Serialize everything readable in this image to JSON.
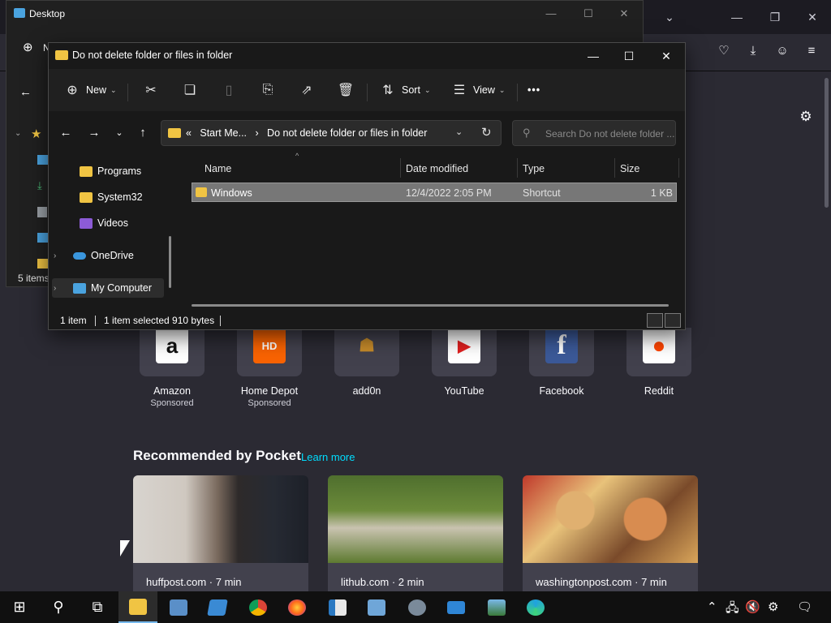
{
  "firefox": {
    "shortcuts": [
      {
        "name": "Amazon",
        "sponsor": "Sponsored",
        "logo": "a"
      },
      {
        "name": "Home Depot",
        "sponsor": "Sponsored",
        "logo": "HD"
      },
      {
        "name": "add0n",
        "sponsor": "",
        "logo": "☗"
      },
      {
        "name": "YouTube",
        "sponsor": "",
        "logo": "▶"
      },
      {
        "name": "Facebook",
        "sponsor": "",
        "logo": "f"
      },
      {
        "name": "Reddit",
        "sponsor": "",
        "logo": "●"
      }
    ],
    "pocket": {
      "title": "Recommended by Pocket",
      "learn_more": "Learn more",
      "cards": [
        {
          "source": "huffpost.com · 7 min"
        },
        {
          "source": "lithub.com · 2 min"
        },
        {
          "source": "washingtonpost.com · 7 min"
        }
      ]
    }
  },
  "bg_explorer": {
    "title": "Desktop",
    "status": "5 items",
    "new_partial": "N"
  },
  "explorer": {
    "title": "Do not delete folder or files in folder",
    "commands": {
      "new": "New",
      "sort": "Sort",
      "view": "View",
      "more": "•••"
    },
    "address": {
      "overflow": "«",
      "crumb1": "Start Me...",
      "sep": "›",
      "crumb2": "Do not delete folder or files in folder"
    },
    "search_placeholder": "Search Do not delete folder ...",
    "tree": {
      "items": [
        {
          "label": "Programs"
        },
        {
          "label": "System32"
        },
        {
          "label": "Videos"
        },
        {
          "label": "OneDrive"
        },
        {
          "label": "My Computer"
        }
      ]
    },
    "columns": {
      "name": "Name",
      "date": "Date modified",
      "type": "Type",
      "size": "Size"
    },
    "rows": [
      {
        "name": "Windows",
        "date": "12/4/2022 2:05 PM",
        "type": "Shortcut",
        "size": "1 KB"
      }
    ],
    "status": {
      "count": "1 item",
      "selected": "1 item selected  910 bytes"
    }
  },
  "colors": {
    "folder": "#f0c443",
    "accent": "#76b9ed",
    "pocket_link": "#00ddff"
  }
}
